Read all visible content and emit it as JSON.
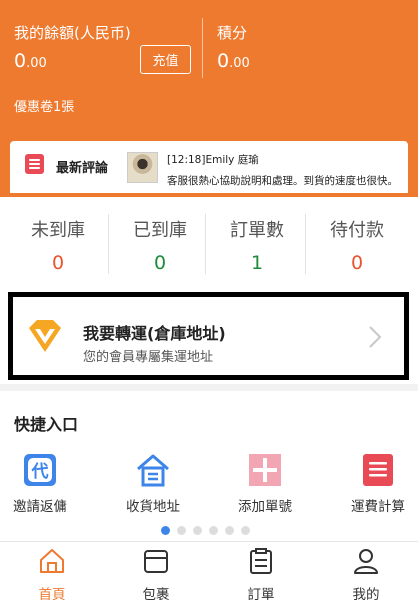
{
  "wallet": {
    "balance_label": "我的餘額(人民币)",
    "balance_int": "0",
    "balance_dec": ".00",
    "recharge_label": "充值",
    "points_label": "積分",
    "points_int": "0",
    "points_dec": ".00",
    "coupon_label": "優惠卷1張"
  },
  "review": {
    "title": "最新評論",
    "meta": "[12:18]Emily 庭瑜",
    "text": "客服很熱心協助說明和處理。到貨的速度也很快。"
  },
  "stats": [
    {
      "label": "未到庫",
      "value": "0",
      "color": "#e8542f"
    },
    {
      "label": "已到庫",
      "value": "0",
      "color": "#1f8a3a"
    },
    {
      "label": "訂單數",
      "value": "1",
      "color": "#1f8a3a"
    },
    {
      "label": "待付款",
      "value": "0",
      "color": "#e8542f"
    }
  ],
  "shipping": {
    "title": "我要轉運(倉庫地址)",
    "subtitle": "您的會員專屬集運地址"
  },
  "quick": {
    "title": "快捷入口",
    "items": [
      {
        "label": "邀請返傭",
        "icon": "invite-rebate-icon",
        "icon_glyph": "代"
      },
      {
        "label": "收貨地址",
        "icon": "address-home-icon"
      },
      {
        "label": "添加單號",
        "icon": "add-tracking-icon"
      },
      {
        "label": "運費計算",
        "icon": "freight-calculator-icon"
      }
    ],
    "pages": 6,
    "active_page": 1
  },
  "nav": [
    {
      "label": "首頁",
      "icon": "home-icon",
      "active": true
    },
    {
      "label": "包裹",
      "icon": "package-icon",
      "active": false
    },
    {
      "label": "訂單",
      "icon": "order-icon",
      "active": false
    },
    {
      "label": "我的",
      "icon": "profile-icon",
      "active": false
    }
  ],
  "colors": {
    "accent": "#ee7a2f",
    "blue": "#3d85e8",
    "red": "#e84b55",
    "green": "#1f8a3a"
  }
}
